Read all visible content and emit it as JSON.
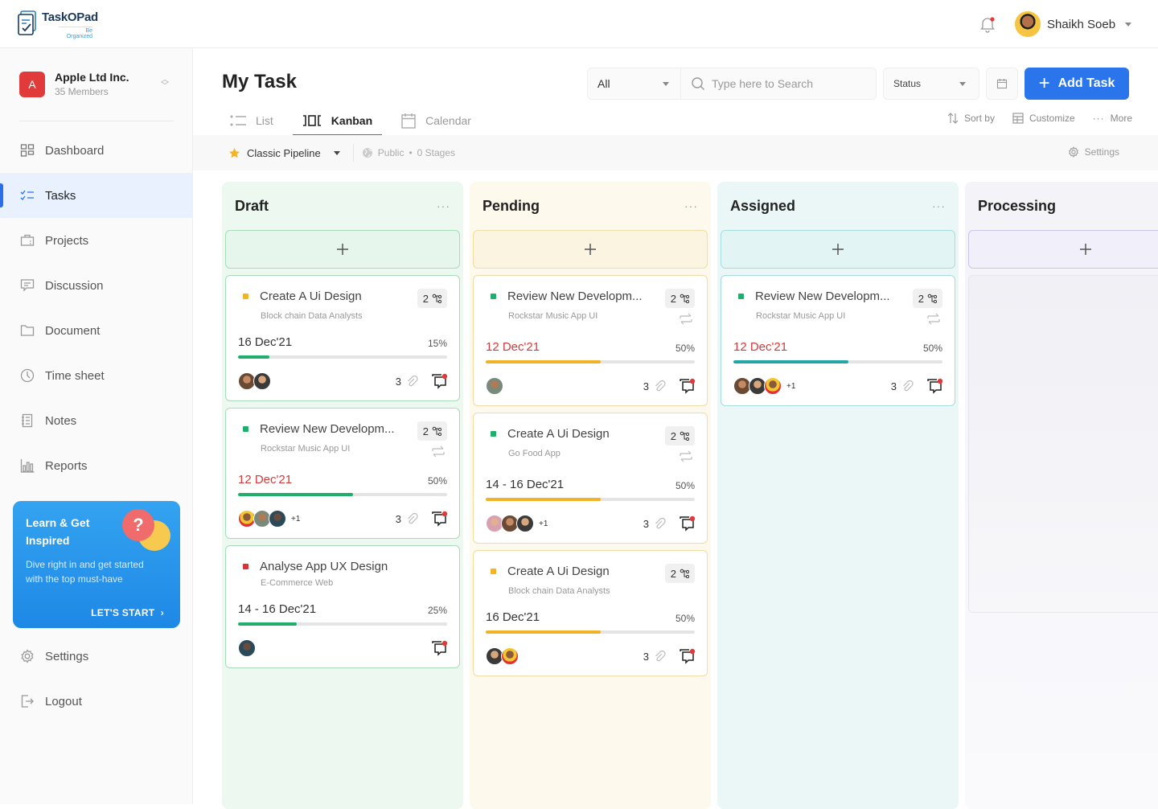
{
  "app": {
    "name": "TaskOPad",
    "tagline": "Be Organized"
  },
  "header": {
    "user_name": "Shaikh Soeb",
    "notification_dot": true
  },
  "sidebar": {
    "org": {
      "initial": "A",
      "name": "Apple Ltd Inc.",
      "members": "35 Members"
    },
    "items": [
      {
        "label": "Dashboard",
        "icon": "dashboard-icon"
      },
      {
        "label": "Tasks",
        "icon": "tasks-icon",
        "active": true
      },
      {
        "label": "Projects",
        "icon": "projects-icon"
      },
      {
        "label": "Discussion",
        "icon": "discussion-icon"
      },
      {
        "label": "Document",
        "icon": "folder-icon"
      },
      {
        "label": "Time sheet",
        "icon": "clock-icon"
      },
      {
        "label": "Notes",
        "icon": "notes-icon"
      },
      {
        "label": "Reports",
        "icon": "reports-icon"
      }
    ],
    "promo": {
      "title": "Learn & Get Inspired",
      "description": "Dive right in and get started with the top must-have",
      "cta": "LET'S START",
      "bubble_glyph": "?"
    },
    "bottom_items": [
      {
        "label": "Settings",
        "icon": "gear-icon"
      },
      {
        "label": "Logout",
        "icon": "logout-icon"
      }
    ]
  },
  "main": {
    "title": "My Task",
    "filter": {
      "value": "All"
    },
    "search": {
      "placeholder": "Type here to Search",
      "value": ""
    },
    "status": {
      "value": "Status"
    },
    "add_button": "Add Task",
    "tabs": [
      {
        "label": "List",
        "active": false
      },
      {
        "label": "Kanban",
        "active": true
      },
      {
        "label": "Calendar",
        "active": false
      }
    ],
    "tools": {
      "sort": "Sort by",
      "customize": "Customize",
      "more": "More"
    },
    "pipeline": {
      "name": "Classic Pipeline",
      "visibility": "Public",
      "separator": "•",
      "stages": "0 Stages",
      "settings": "Settings"
    }
  },
  "colors": {
    "accent": "#2a75ec",
    "priority_low": "#1fae6b",
    "priority_medium": "#f5b223",
    "priority_high": "#d93434",
    "overdue": "#d33a3a",
    "progress_green": "#1fae6b",
    "progress_yellow": "#f0b229",
    "progress_teal": "#22a6a6"
  },
  "board": {
    "columns": [
      {
        "title": "Draft",
        "more": "···",
        "cards": [
          {
            "title": "Create A Ui Design",
            "project": "Block chain Data Analysts",
            "priority": "medium",
            "subtasks": "2",
            "repeat": false,
            "date": "16 Dec'21",
            "overdue": false,
            "progress": 15,
            "progress_label": "15%",
            "assignees": 2,
            "extra_assignees": "",
            "attachments": "3"
          },
          {
            "title": "Review New Developm...",
            "project": "Rockstar Music App UI",
            "priority": "low",
            "subtasks": "2",
            "repeat": true,
            "date": "12 Dec'21",
            "overdue": true,
            "progress": 55,
            "progress_label": "50%",
            "assignees": 3,
            "extra_assignees": "+1",
            "attachments": "3"
          },
          {
            "title": "Analyse App UX Design",
            "project": "E-Commerce Web",
            "priority": "high",
            "subtasks": "",
            "repeat": false,
            "date": "14 -  16 Dec'21",
            "overdue": false,
            "progress": 28,
            "progress_label": "25%",
            "assignees": 1,
            "extra_assignees": "",
            "attachments": ""
          }
        ]
      },
      {
        "title": "Pending",
        "more": "···",
        "cards": [
          {
            "title": "Review New Developm...",
            "project": "Rockstar Music App UI",
            "priority": "low",
            "subtasks": "2",
            "repeat": true,
            "date": "12 Dec'21",
            "overdue": true,
            "progress": 55,
            "progress_label": "50%",
            "assignees": 1,
            "extra_assignees": "",
            "attachments": "3"
          },
          {
            "title": "Create A Ui Design",
            "project": "Go Food App",
            "priority": "low",
            "subtasks": "2",
            "repeat": true,
            "date": "14 -  16 Dec'21",
            "overdue": false,
            "progress": 55,
            "progress_label": "50%",
            "assignees": 3,
            "extra_assignees": "+1",
            "attachments": "3"
          },
          {
            "title": "Create A Ui Design",
            "project": "Block chain Data Analysts",
            "priority": "medium",
            "subtasks": "2",
            "repeat": false,
            "date": "16 Dec'21",
            "overdue": false,
            "progress": 55,
            "progress_label": "50%",
            "assignees": 2,
            "extra_assignees": "",
            "attachments": "3"
          }
        ]
      },
      {
        "title": "Assigned",
        "more": "···",
        "cards": [
          {
            "title": "Review New Developm...",
            "project": "Rockstar Music App UI",
            "priority": "low",
            "subtasks": "2",
            "repeat": true,
            "date": "12 Dec'21",
            "overdue": true,
            "progress": 55,
            "progress_label": "50%",
            "assignees": 3,
            "extra_assignees": "+1",
            "attachments": "3"
          }
        ]
      },
      {
        "title": "Processing",
        "more": "",
        "cards": []
      }
    ]
  }
}
